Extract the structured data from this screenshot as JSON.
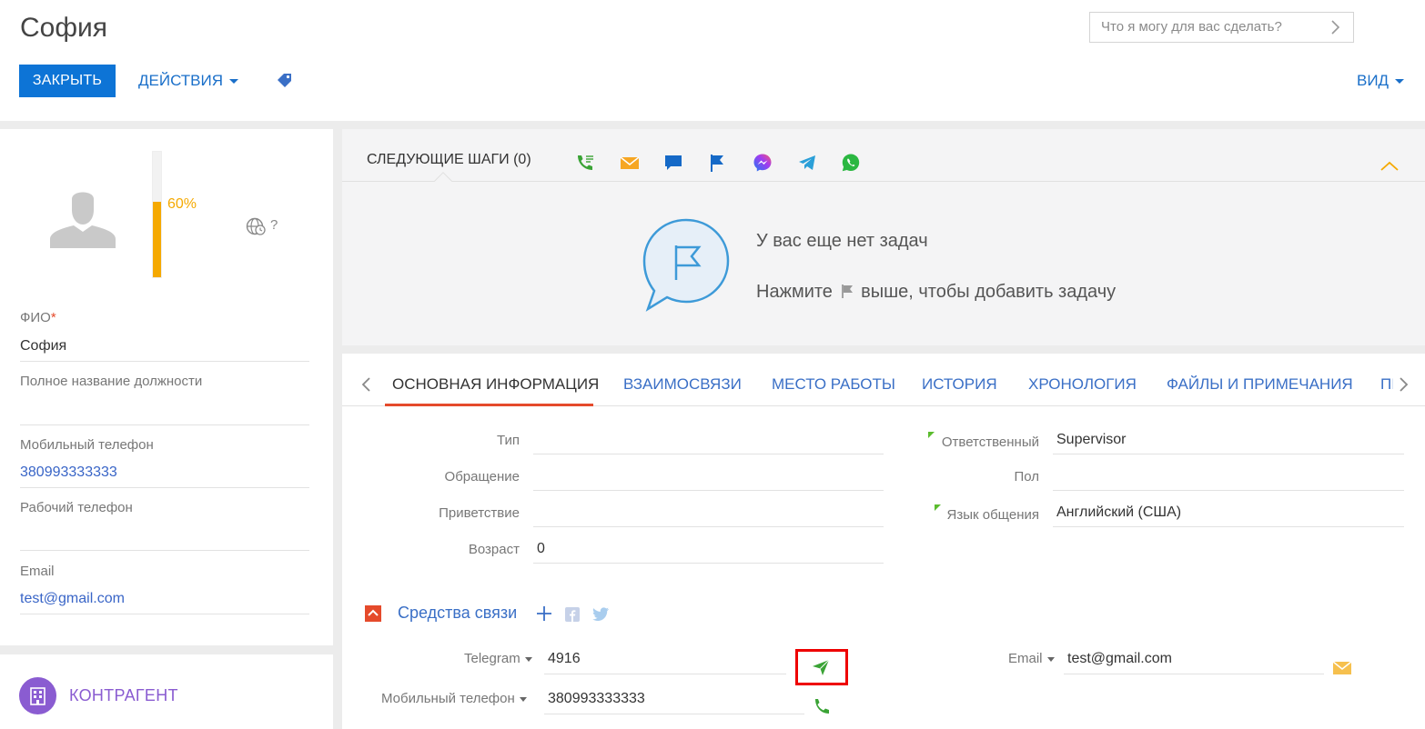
{
  "header": {
    "title": "София",
    "search_placeholder": "Что я могу для вас сделать?",
    "close_label": "ЗАКРЫТЬ",
    "actions_label": "ДЕЙСТВИЯ",
    "view_label": "ВИД"
  },
  "profile": {
    "completeness_label": "60%",
    "completeness": 0.6,
    "timezone_unknown": "?",
    "fields": {
      "fio_label": "ФИО",
      "fio_required": "*",
      "fio_value": "София",
      "job_title_label": "Полное название должности",
      "mobile_label": "Мобильный телефон",
      "mobile_value": "380993333333",
      "work_phone_label": "Рабочий телефон",
      "email_label": "Email",
      "email_value": "test@gmail.com"
    },
    "account_label": "КОНТРАГЕНТ"
  },
  "next_steps": {
    "title": "СЛЕДУЮЩИЕ ШАГИ (0)",
    "icons": [
      "call-icon",
      "email-icon",
      "chat-icon",
      "flag-icon",
      "messenger-icon",
      "telegram-icon",
      "whatsapp-icon"
    ],
    "empty_title": "У вас еще нет задач",
    "empty_hint_before": "Нажмите",
    "empty_hint_after": "выше, чтобы добавить задачу"
  },
  "tabs": [
    {
      "label": "ОСНОВНАЯ ИНФОРМАЦИЯ",
      "active": true
    },
    {
      "label": "ВЗАИМОСВЯЗИ"
    },
    {
      "label": "МЕСТО РАБОТЫ"
    },
    {
      "label": "ИСТОРИЯ"
    },
    {
      "label": "ХРОНОЛОГИЯ"
    },
    {
      "label": "ФАЙЛЫ И ПРИМЕЧАНИЯ"
    },
    {
      "label": "ПІ"
    }
  ],
  "details": {
    "type_label": "Тип",
    "salutation_label": "Обращение",
    "greeting_label": "Приветствие",
    "age_label": "Возраст",
    "age_value": "0",
    "owner_label": "Ответственный",
    "owner_value": "Supervisor",
    "gender_label": "Пол",
    "language_label": "Язык общения",
    "language_value": "Английский (США)"
  },
  "communications": {
    "section_title": "Средства связи",
    "telegram_label": "Telegram",
    "telegram_value": "4916",
    "mobile_label": "Мобильный телефон",
    "mobile_value": "380993333333",
    "email_label": "Email",
    "email_value": "test@gmail.com"
  },
  "colors": {
    "accent": "#0d74d6",
    "link": "#3a6fc6",
    "progress": "#f5a900",
    "tab_underline": "#e54a2b",
    "account": "#8a5cd1",
    "highlight": "#e00000"
  }
}
